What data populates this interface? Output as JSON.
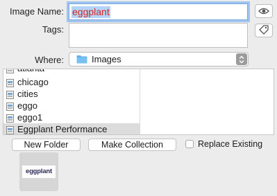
{
  "form": {
    "image_name_label": "Image Name:",
    "image_name_value": "eggplant",
    "tags_label": "Tags:",
    "tags_value": "",
    "where_label": "Where:",
    "where_value": "Images"
  },
  "icons": {
    "preview": "eye-icon",
    "tags": "tag-icon",
    "folder": "folder-icon",
    "select": "updown-chevron-icon",
    "file": "image-file-icon"
  },
  "file_list": [
    {
      "name": "atlanta",
      "selected": false
    },
    {
      "name": "chicago",
      "selected": false
    },
    {
      "name": "cities",
      "selected": false
    },
    {
      "name": "eggo",
      "selected": false
    },
    {
      "name": "eggo1",
      "selected": false
    },
    {
      "name": "Eggplant Performance",
      "selected": true
    }
  ],
  "buttons": {
    "new_folder": "New Folder",
    "make_collection": "Make Collection",
    "replace_existing": "Replace Existing"
  },
  "thumbnail": {
    "logo_text": "eggplant"
  },
  "colors": {
    "accent": "#b5d3f7",
    "name_text": "#d8251c",
    "folder": "#5fb2ec"
  }
}
